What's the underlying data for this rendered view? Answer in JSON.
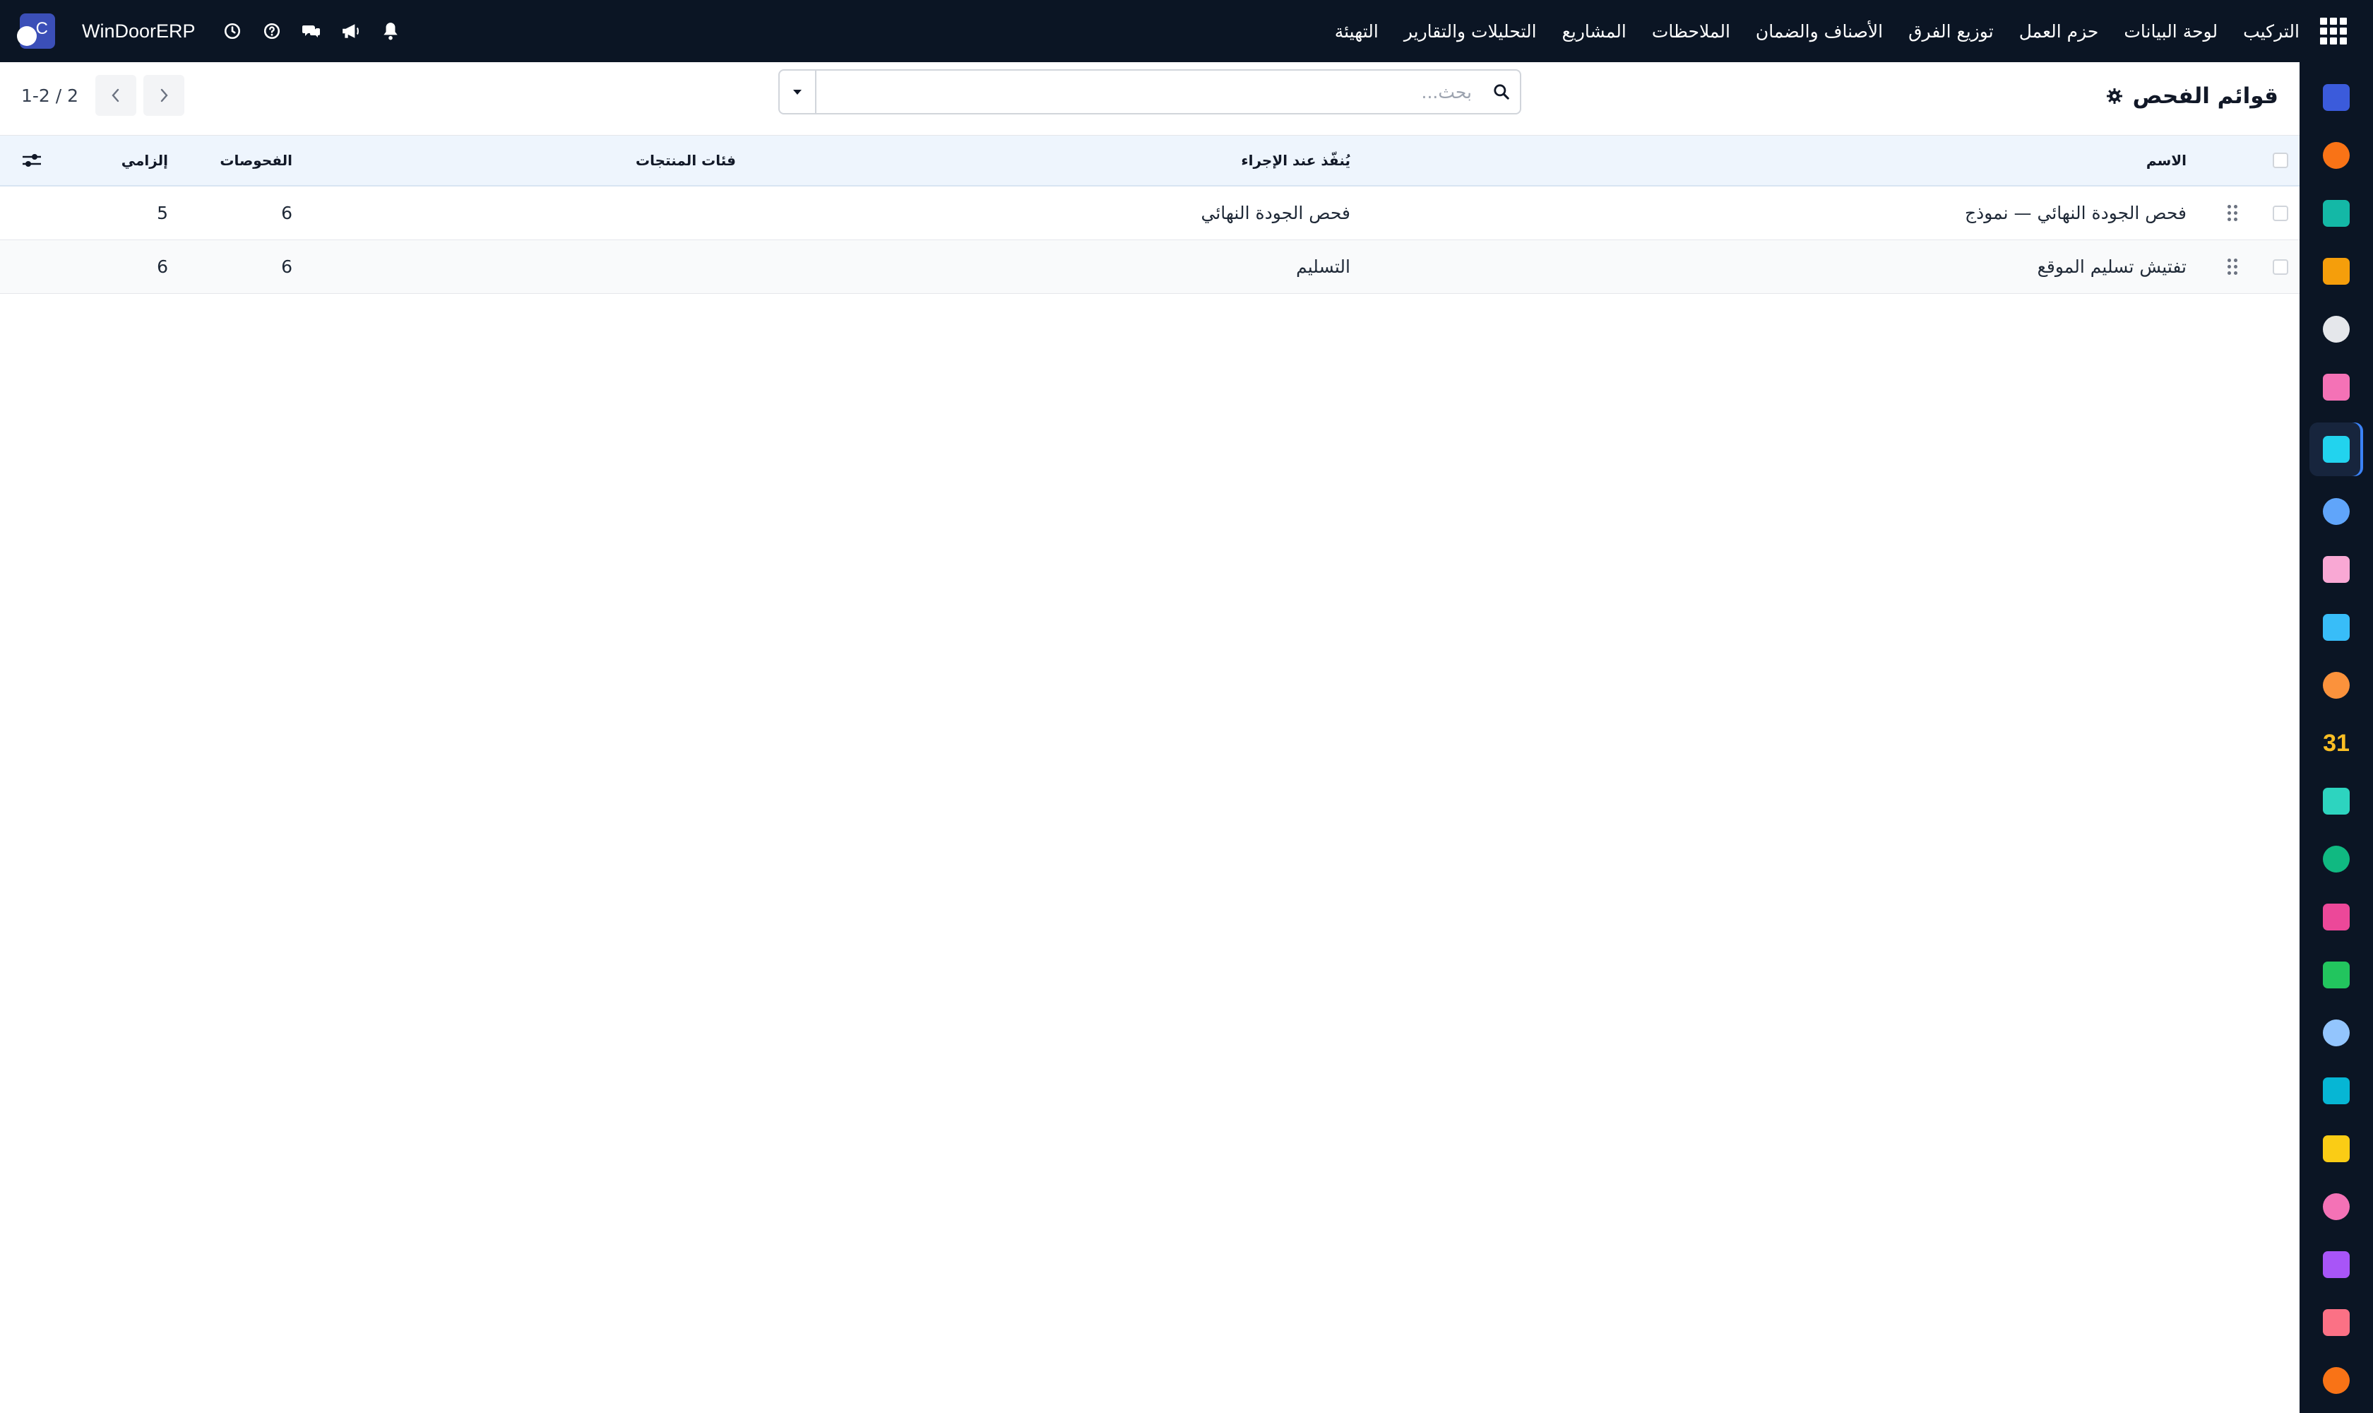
{
  "navbar": {
    "menu": [
      "التركيب",
      "لوحة البيانات",
      "حزم العمل",
      "توزيع الفرق",
      "الأصناف والضمان",
      "الملاحظات",
      "المشاريع",
      "التحليلات والتقارير",
      "التهيئة"
    ],
    "company": "WinDoorERP",
    "avatar_letter": "C",
    "tools": [
      "bell-icon",
      "megaphone-icon",
      "chat-icon",
      "help-icon",
      "clock-icon"
    ]
  },
  "control": {
    "title": "قوائم الفحص",
    "search_placeholder": "بحث...",
    "pager": {
      "value": "1-2 / 2"
    }
  },
  "table": {
    "columns": {
      "name": "الاسم",
      "trigger": "يُنفّذ عند الإجراء",
      "product_categories": "فئات المنتجات",
      "checks": "الفحوصات",
      "required": "إلزامي"
    },
    "rows": [
      {
        "name": "فحص الجودة النهائي — نموذج",
        "trigger": "فحص الجودة النهائي",
        "product_categories": "",
        "checks": "6",
        "required": "5"
      },
      {
        "name": "تفتيش تسليم الموقع",
        "trigger": "التسليم",
        "product_categories": "",
        "checks": "6",
        "required": "6"
      }
    ]
  },
  "rail": {
    "apps": [
      {
        "icon": "mail-app-icon",
        "color": "#3b5bdb"
      },
      {
        "icon": "chat-bubble-app-icon",
        "color": "#f97316"
      },
      {
        "icon": "discuss-app-icon",
        "color": "#14b8a6"
      },
      {
        "icon": "dashboard-app-icon",
        "color": "#f59e0b"
      },
      {
        "icon": "inventory-app-icon",
        "color": "#e5e7eb"
      },
      {
        "icon": "gallery-app-icon",
        "color": "#f472b6"
      },
      {
        "icon": "checklist-app-icon",
        "color": "#22d3ee"
      },
      {
        "icon": "knowledge-app-icon",
        "color": "#60a5fa"
      },
      {
        "icon": "box-app-icon",
        "color": "#f9a8d4"
      },
      {
        "icon": "invoice-app-icon",
        "color": "#38bdf8"
      },
      {
        "icon": "employees-app-icon",
        "color": "#fb923c"
      },
      {
        "icon": "calendar-app-icon",
        "color": "#fbbf24"
      },
      {
        "icon": "sign-app-icon",
        "color": "#2dd4bf"
      },
      {
        "icon": "contacts-app-icon",
        "color": "#10b981"
      },
      {
        "icon": "dashboards-app-icon",
        "color": "#ec4899"
      },
      {
        "icon": "whatsapp-app-icon",
        "color": "#22c55e"
      },
      {
        "icon": "timer-app-icon",
        "color": "#93c5fd"
      },
      {
        "icon": "wave-app-icon",
        "color": "#06b6d4"
      },
      {
        "icon": "send-app-icon",
        "color": "#facc15"
      },
      {
        "icon": "sheet-app-icon",
        "color": "#f472b6"
      },
      {
        "icon": "hexagon-app-icon",
        "color": "#a855f7"
      },
      {
        "icon": "pie-app-icon",
        "color": "#fb7185"
      },
      {
        "icon": "plugin-app-icon",
        "color": "#f97316"
      }
    ]
  }
}
